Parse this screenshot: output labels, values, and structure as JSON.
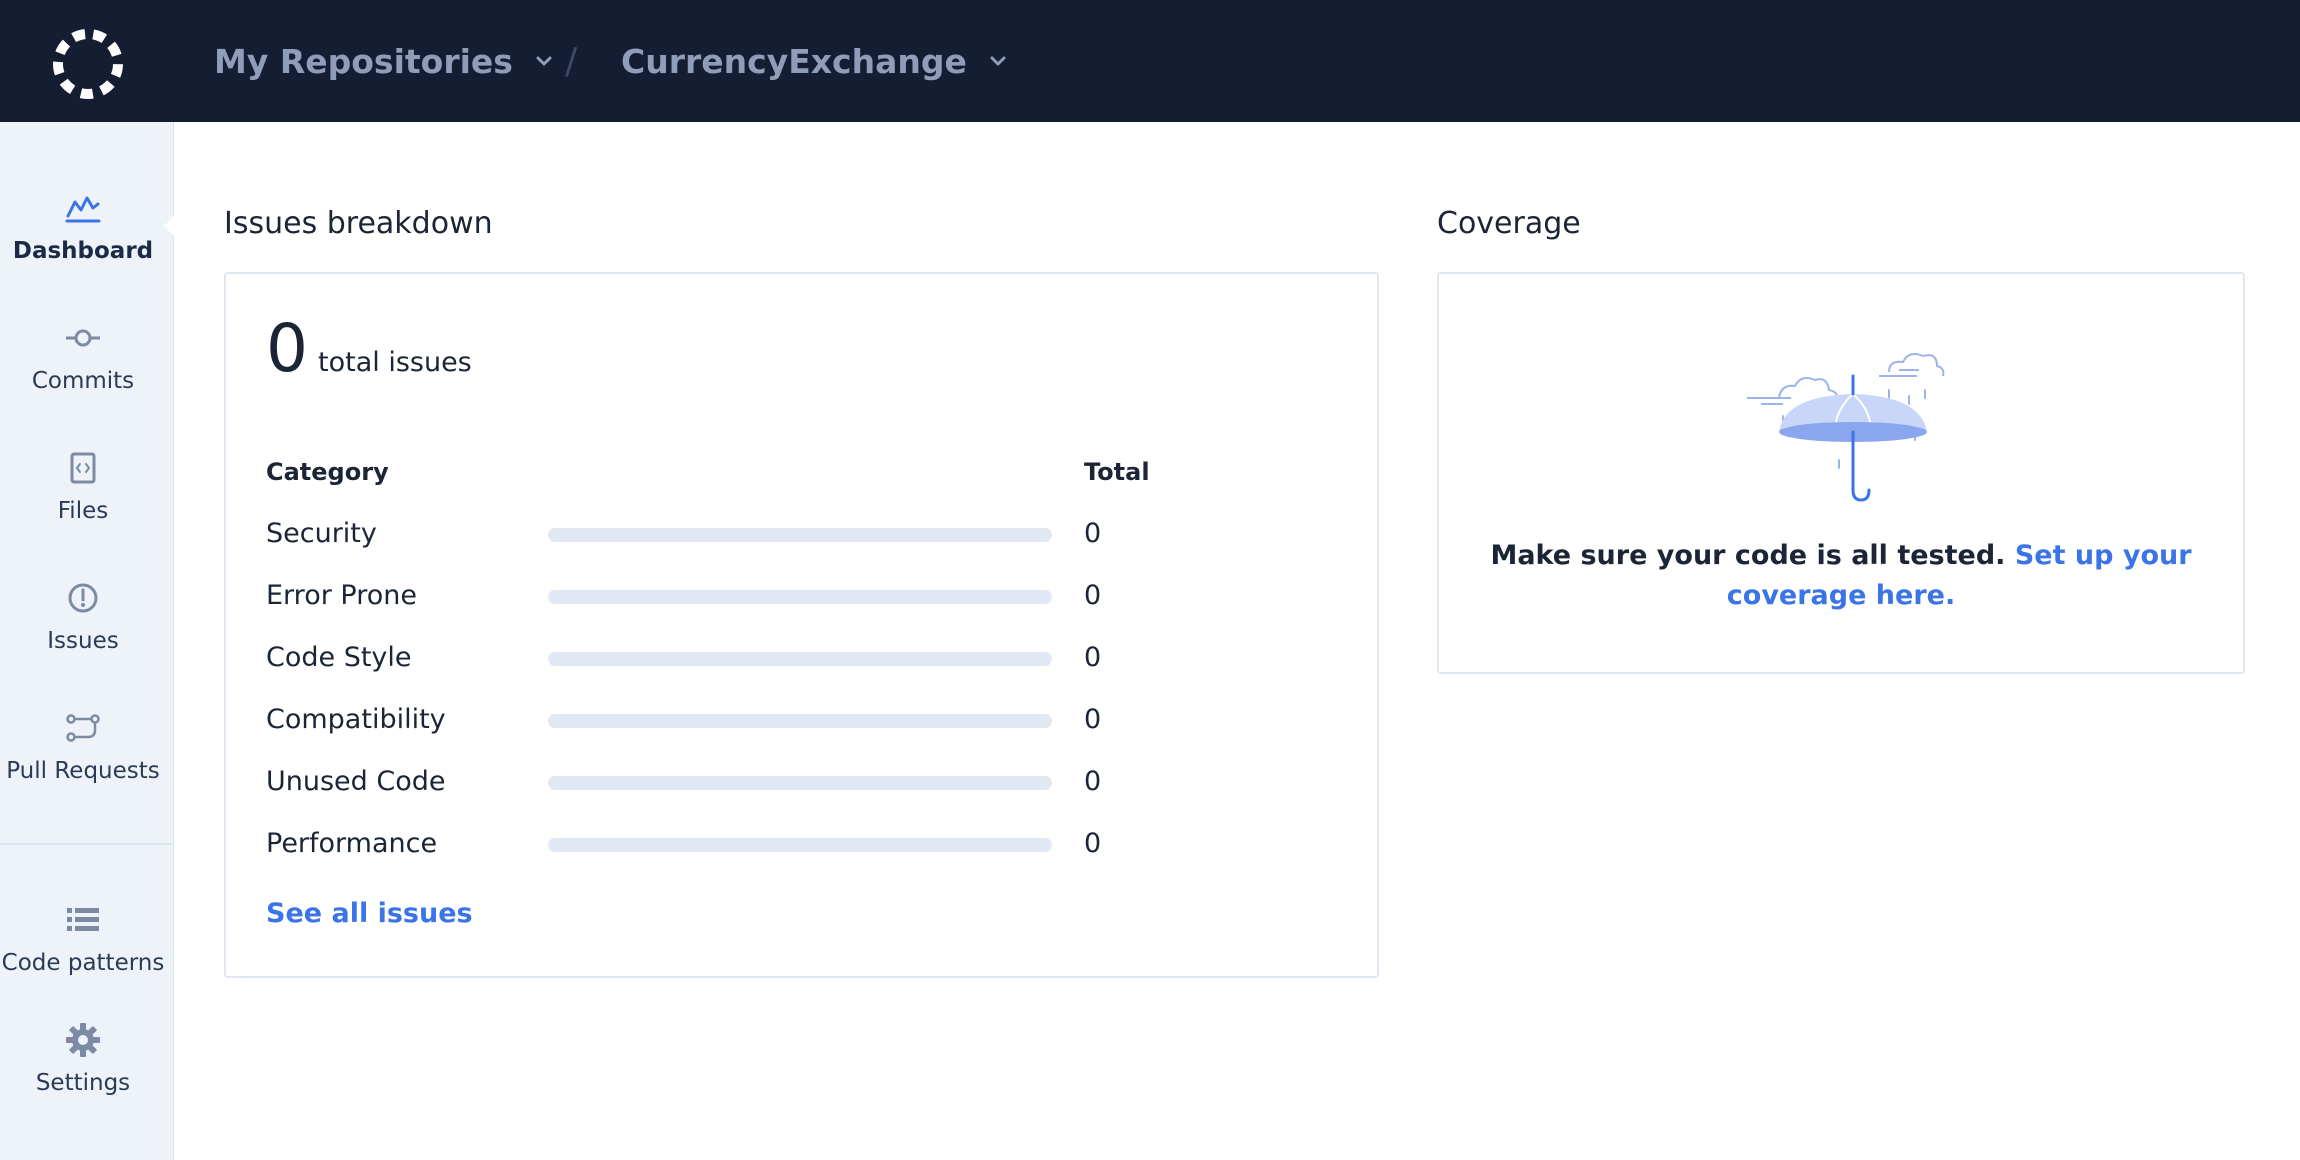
{
  "header": {
    "repos_label": "My Repositories",
    "separator": "/",
    "project_label": "CurrencyExchange"
  },
  "sidebar": {
    "items": [
      {
        "label": "Dashboard",
        "icon": "dashboard-chart-icon",
        "active": true
      },
      {
        "label": "Commits",
        "icon": "commit-icon"
      },
      {
        "label": "Files",
        "icon": "file-code-icon"
      },
      {
        "label": "Issues",
        "icon": "alert-circle-icon"
      },
      {
        "label": "Pull Requests",
        "icon": "pull-request-icon"
      },
      {
        "label": "Code patterns",
        "icon": "list-icon"
      },
      {
        "label": "Settings",
        "icon": "gear-icon"
      }
    ]
  },
  "issues": {
    "section_title": "Issues breakdown",
    "total": "0",
    "total_label": "total issues",
    "col_category": "Category",
    "col_total": "Total",
    "rows": [
      {
        "category": "Security",
        "count": "0",
        "fraction": 0
      },
      {
        "category": "Error Prone",
        "count": "0",
        "fraction": 0
      },
      {
        "category": "Code Style",
        "count": "0",
        "fraction": 0
      },
      {
        "category": "Compatibility",
        "count": "0",
        "fraction": 0
      },
      {
        "category": "Unused Code",
        "count": "0",
        "fraction": 0
      },
      {
        "category": "Performance",
        "count": "0",
        "fraction": 0
      }
    ],
    "see_all": "See all issues"
  },
  "coverage": {
    "section_title": "Coverage",
    "illustration": "umbrella-illustration",
    "message": "Make sure your code is all tested.",
    "link": "Set up your coverage here."
  },
  "colors": {
    "topbar": "#141d31",
    "sidebar": "#eef3f9",
    "accent": "#3b74e6",
    "bar_track": "#e2e8f3"
  }
}
